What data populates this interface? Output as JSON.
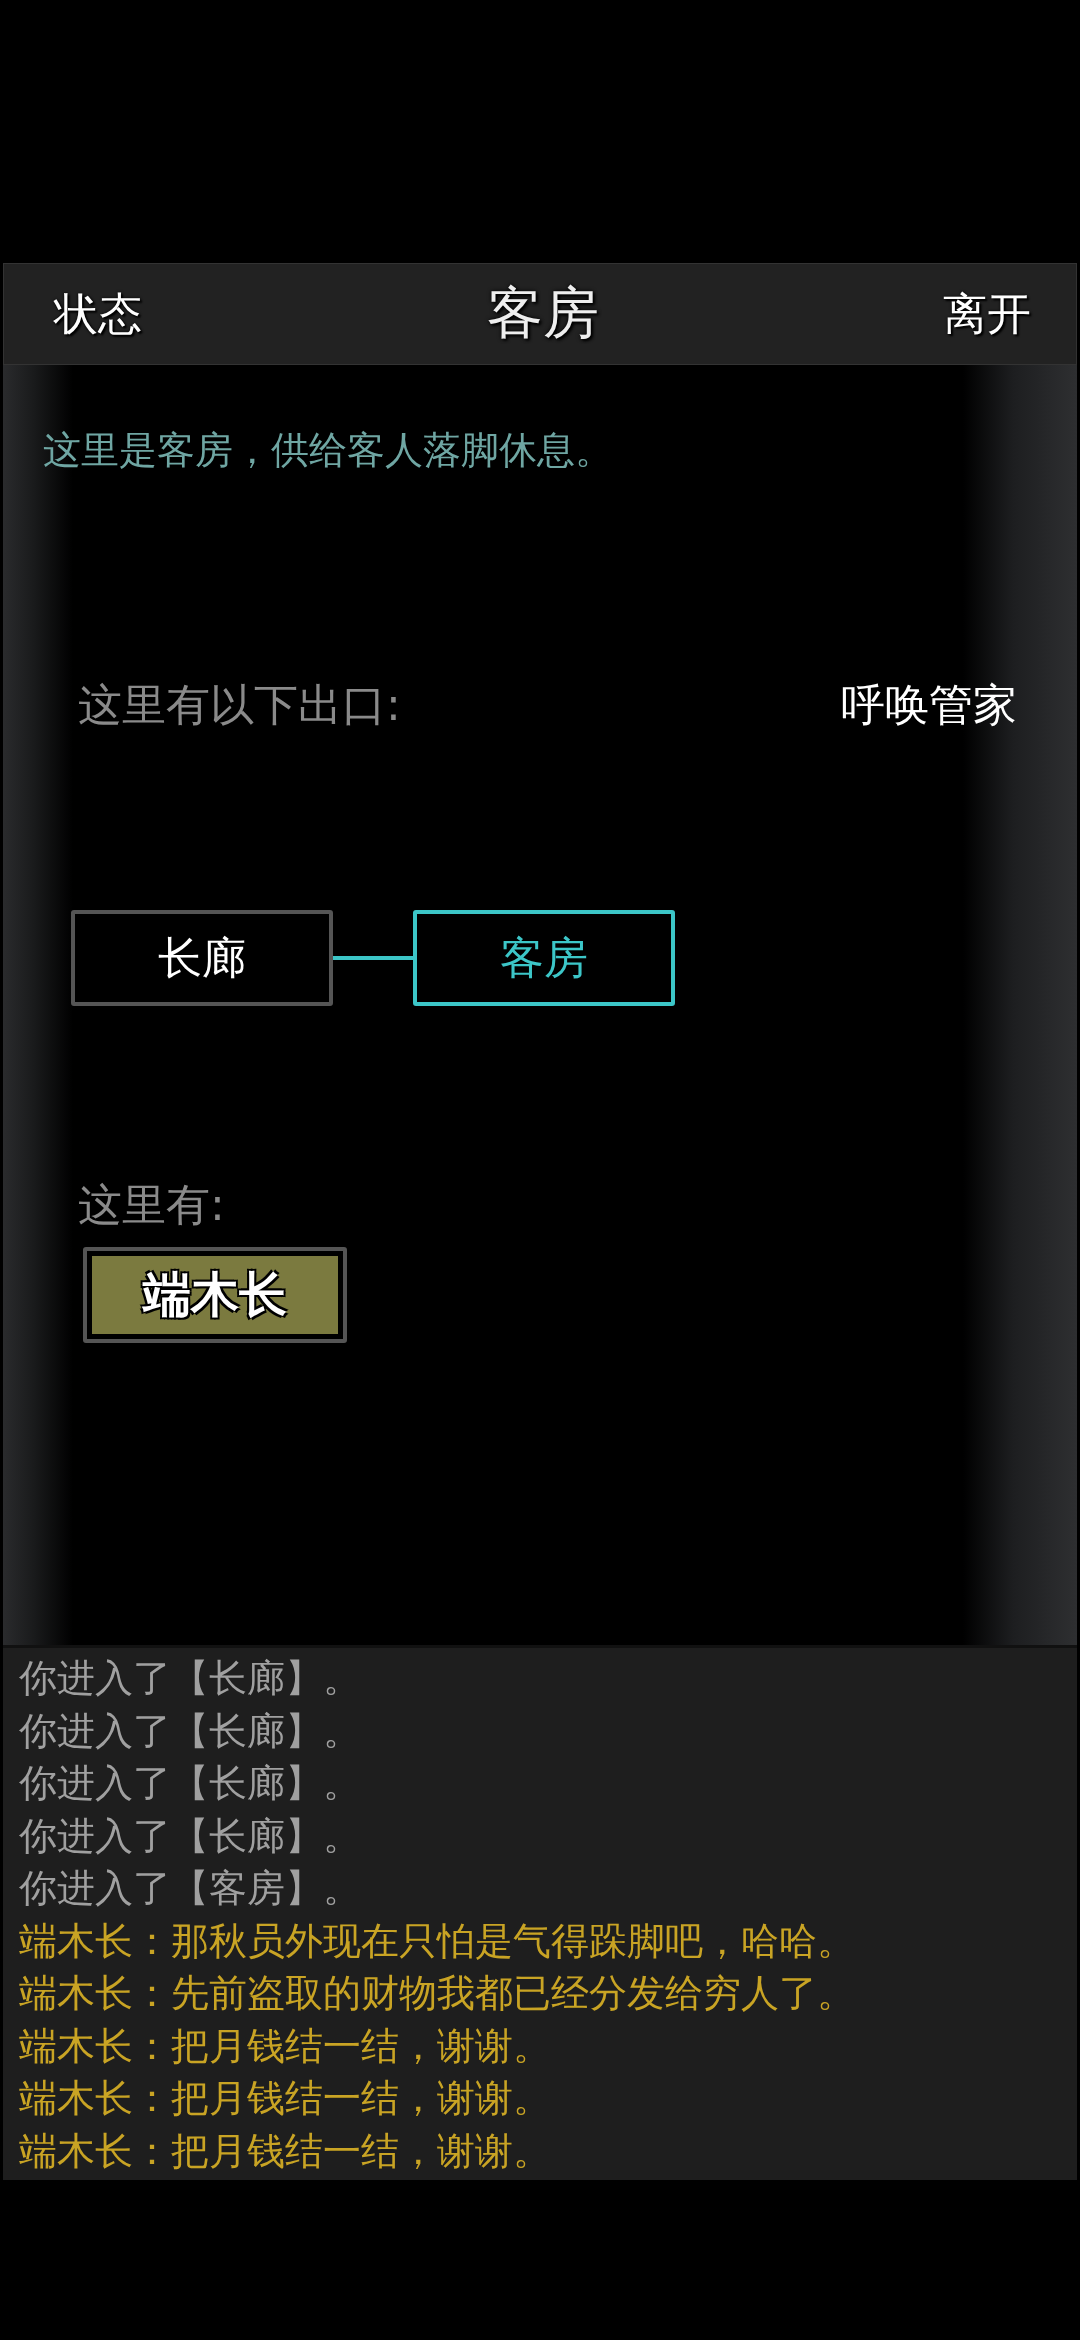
{
  "header": {
    "left_button": "状态",
    "title": "客房",
    "right_button": "离开"
  },
  "description": "这里是客房，供给客人落脚休息。",
  "exits": {
    "label": "这里有以下出口:",
    "action": "呼唤管家",
    "rooms": [
      {
        "name": "长廊",
        "selected": false
      },
      {
        "name": "客房",
        "selected": true
      }
    ]
  },
  "present": {
    "label": "这里有:",
    "npcs": [
      "端木长"
    ]
  },
  "log": [
    {
      "kind": "system",
      "text": "你进入了【长廊】。"
    },
    {
      "kind": "system",
      "text": "你进入了【长廊】。"
    },
    {
      "kind": "system",
      "text": "你进入了【长廊】。"
    },
    {
      "kind": "system",
      "text": "你进入了【长廊】。"
    },
    {
      "kind": "system",
      "text": "你进入了【客房】。"
    },
    {
      "kind": "dialogue",
      "text": "端木长：那秋员外现在只怕是气得跺脚吧，哈哈。"
    },
    {
      "kind": "dialogue",
      "text": "端木长：先前盗取的财物我都已经分发给穷人了。"
    },
    {
      "kind": "dialogue",
      "text": "端木长：把月钱结一结，谢谢。"
    },
    {
      "kind": "dialogue",
      "text": "端木长：把月钱结一结，谢谢。"
    },
    {
      "kind": "dialogue",
      "text": "端木长：把月钱结一结，谢谢。"
    }
  ]
}
